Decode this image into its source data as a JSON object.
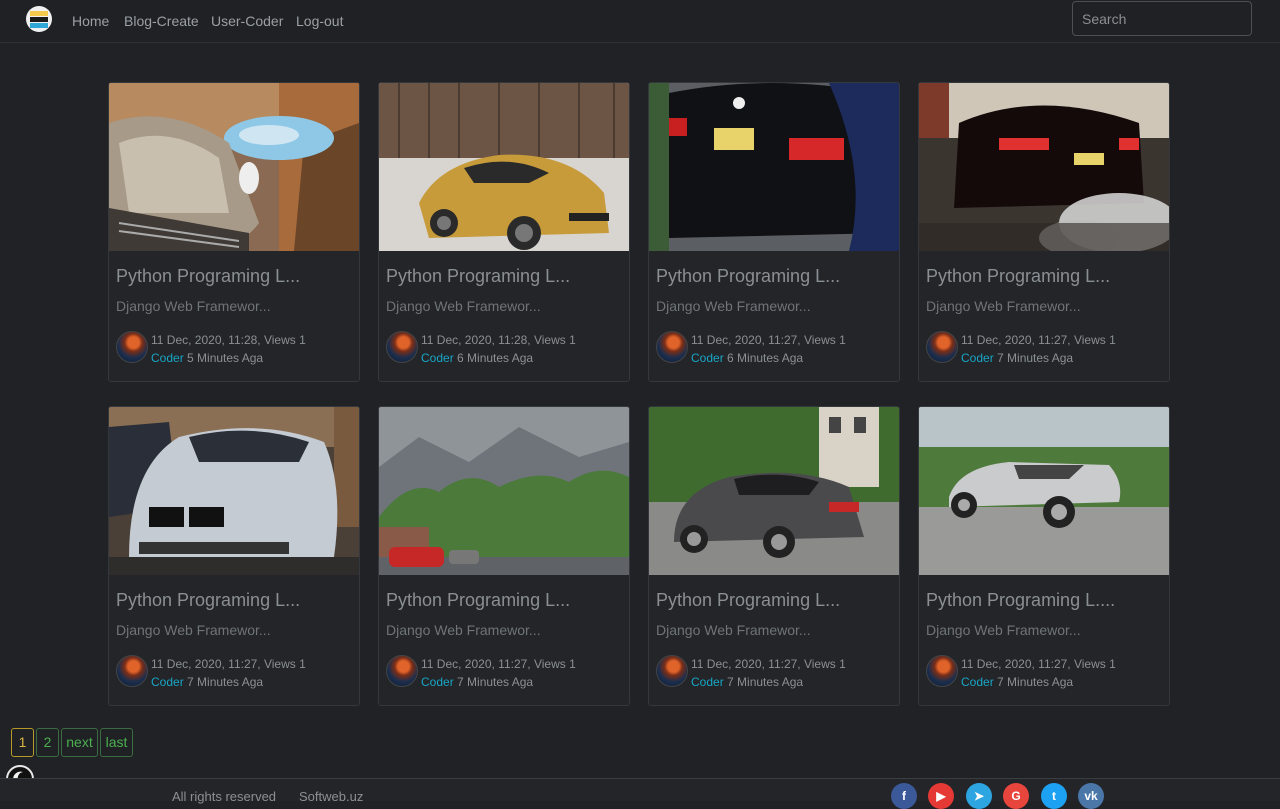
{
  "nav": {
    "links": [
      "Home",
      "Blog-Create",
      "User-Coder",
      "Log-out"
    ],
    "search_placeholder": "Search"
  },
  "cards": [
    {
      "title": "Python Programing L...",
      "desc": "Django Web Framewor...",
      "date": "11 Dec, 2020, 11:28, Views 1",
      "author": "Coder",
      "ago": "5 Minutes Aga",
      "image": "sports-car-hood-driveway"
    },
    {
      "title": "Python Programing L...",
      "desc": "Django Web Framewor...",
      "date": "11 Dec, 2020, 11:28, Views 1",
      "author": "Coder",
      "ago": "6 Minutes Aga",
      "image": "gold-bmw-snow"
    },
    {
      "title": "Python Programing L...",
      "desc": "Django Web Framewor...",
      "date": "11 Dec, 2020, 11:27, Views 1",
      "author": "Coder",
      "ago": "6 Minutes Aga",
      "image": "black-bmw-covered"
    },
    {
      "title": "Python Programing L...",
      "desc": "Django Web Framewor...",
      "date": "11 Dec, 2020, 11:27, Views 1",
      "author": "Coder",
      "ago": "7 Minutes Aga",
      "image": "bmw-burnout-smoke"
    },
    {
      "title": "Python Programing L...",
      "desc": "Django Web Framewor...",
      "date": "11 Dec, 2020, 11:27, Views 1",
      "author": "Coder",
      "ago": "7 Minutes Aga",
      "image": "silver-bmw-m4"
    },
    {
      "title": "Python Programing L...",
      "desc": "Django Web Framewor...",
      "date": "11 Dec, 2020, 11:27, Views 1",
      "author": "Coder",
      "ago": "7 Minutes Aga",
      "image": "mountain-road-red-car"
    },
    {
      "title": "Python Programing L...",
      "desc": "Django Web Framewor...",
      "date": "11 Dec, 2020, 11:27, Views 1",
      "author": "Coder",
      "ago": "7 Minutes Aga",
      "image": "rolls-royce-wraith"
    },
    {
      "title": "Python Programing L....",
      "desc": "Django Web Framewor...",
      "date": "11 Dec, 2020, 11:27, Views 1",
      "author": "Coder",
      "ago": "7 Minutes Aga",
      "image": "delorean"
    }
  ],
  "pagination": {
    "pages": [
      "1",
      "2"
    ],
    "next": "next",
    "last": "last",
    "current": "1"
  },
  "footer": {
    "copyright": "All rights reserved",
    "site": "Softweb.uz",
    "social": [
      {
        "icon": "facebook-icon",
        "glyph": "f",
        "color": "#3b5998"
      },
      {
        "icon": "youtube-icon",
        "glyph": "▶",
        "color": "#e53935"
      },
      {
        "icon": "telegram-icon",
        "glyph": "➤",
        "color": "#2ca5e0"
      },
      {
        "icon": "google-icon",
        "glyph": "G",
        "color": "#e8453c"
      },
      {
        "icon": "twitter-icon",
        "glyph": "t",
        "color": "#1da1f2"
      },
      {
        "icon": "vk-icon",
        "glyph": "vk",
        "color": "#4a76a8"
      }
    ]
  },
  "colors": {
    "accent_link": "#18a6c7",
    "pagination_green": "#4caf50",
    "pagination_active": "#d9b640"
  }
}
